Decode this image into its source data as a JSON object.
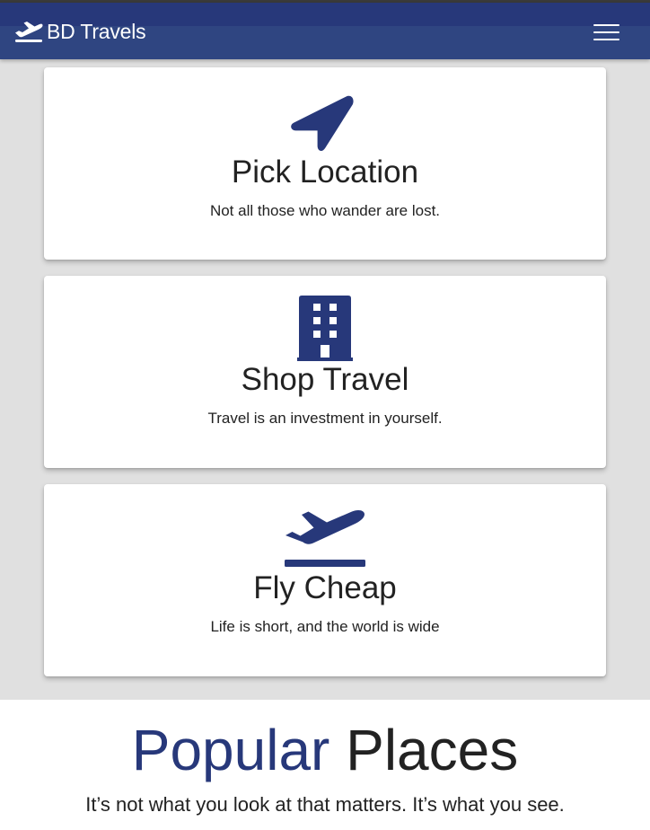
{
  "navbar": {
    "brand": "BD Travels",
    "brand_icon": "airplane-departure-icon",
    "menu_icon": "hamburger-menu-icon"
  },
  "cards": [
    {
      "icon": "location-arrow-icon",
      "title": "Pick Location",
      "text": "Not all those who wander are lost."
    },
    {
      "icon": "building-icon",
      "title": "Shop Travel",
      "text": "Travel is an investment in yourself."
    },
    {
      "icon": "plane-departure-icon",
      "title": "Fly Cheap",
      "text": "Life is short, and the world is wide"
    }
  ],
  "popular": {
    "heading_accent": "Popular",
    "heading_rest": "Places",
    "subtitle": "It’s not what you look at that matters. It’s what you see."
  },
  "colors": {
    "brand": "#27387a",
    "navbar": "#2f4581",
    "page_background": "#e0e0e0",
    "card_background": "#ffffff",
    "text": "#222222"
  }
}
